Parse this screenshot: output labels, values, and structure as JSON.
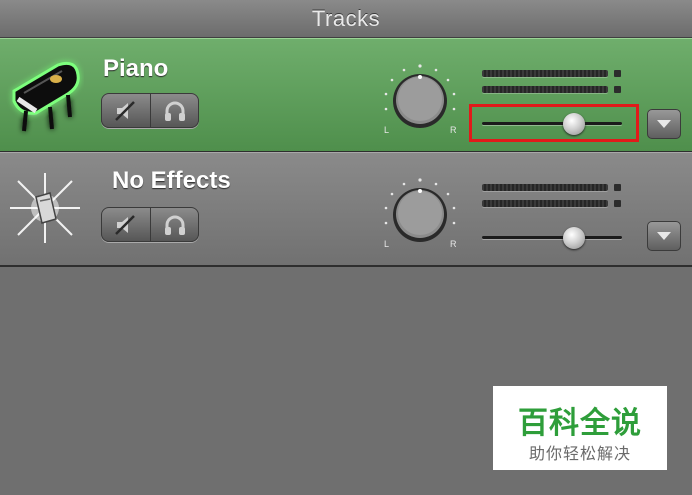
{
  "header": {
    "title": "Tracks"
  },
  "tracks": [
    {
      "name": "Piano",
      "icon": "grand-piano-icon",
      "selected": true,
      "volume_level": 0.66,
      "buttons": {
        "mute": "mute-speaker-icon",
        "solo": "headphones-icon"
      },
      "pan_labels": {
        "left": "L",
        "right": "R"
      }
    },
    {
      "name": "No Effects",
      "icon": "no-effects-sparkle-icon",
      "selected": false,
      "volume_level": 0.66,
      "buttons": {
        "mute": "mute-speaker-icon",
        "solo": "headphones-icon"
      },
      "pan_labels": {
        "left": "L",
        "right": "R"
      }
    }
  ],
  "watermark": {
    "title": "百科全说",
    "subtitle": "助你轻松解决"
  },
  "colors": {
    "selected_track": "#5c9c59",
    "highlight": "#e11a1a",
    "watermark_green": "#2e9e3a"
  }
}
